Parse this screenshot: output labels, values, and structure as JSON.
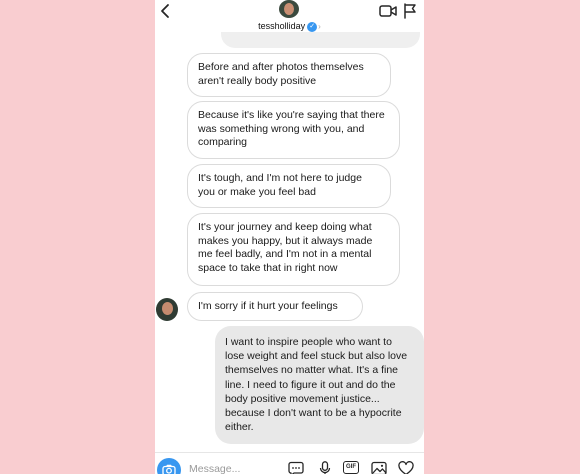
{
  "header": {
    "username": "tessholliday",
    "verified_icon": "verified-badge-icon",
    "verified_mark": "✓",
    "chevron": "›"
  },
  "messages": [
    {
      "sender": "them",
      "text": "Before and after photos themselves aren't really body positive"
    },
    {
      "sender": "them",
      "text": "Because it's like you're saying that there was something wrong with you, and comparing"
    },
    {
      "sender": "them",
      "text": "It's tough, and I'm not here to judge you or make you feel bad"
    },
    {
      "sender": "them",
      "text": "It's your journey and keep doing what makes you happy, but it always made me feel badly, and I'm not in a mental space to take that in right now"
    },
    {
      "sender": "them",
      "text": "I'm sorry if it hurt your feelings"
    },
    {
      "sender": "me",
      "text": "I want to inspire people who want to lose weight and feel stuck but also love themselves no matter what. It's a fine line. I need to figure it out and do the body positive movement justice... because I don't want to be a hypocrite either."
    }
  ],
  "composer": {
    "placeholder": "Message...",
    "gif_label": "GIF"
  },
  "colors": {
    "page_background": "#f9cdd0",
    "accent": "#3897f0",
    "outgoing_bubble": "#e8e8e8"
  }
}
